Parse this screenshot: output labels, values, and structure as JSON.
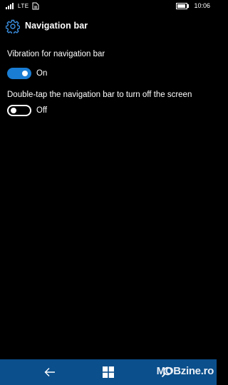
{
  "status_bar": {
    "network": "LTE",
    "time": "10:06",
    "icons": [
      "signal-icon",
      "sim-icon",
      "battery-icon"
    ]
  },
  "header": {
    "title": "Navigation bar",
    "icon": "gear-icon"
  },
  "settings": [
    {
      "label": "Vibration for navigation bar",
      "state": "On",
      "enabled": true
    },
    {
      "label": "Double-tap the navigation bar to turn off the screen",
      "state": "Off",
      "enabled": false
    }
  ],
  "nav_bar": {
    "buttons": [
      "back-icon",
      "windows-icon",
      "search-icon"
    ]
  },
  "watermark": "MOBzine.ro",
  "colors": {
    "accent": "#1a7dd4",
    "nav_bar": "#0b4f8c",
    "background": "#000000",
    "text": "#ffffff"
  }
}
